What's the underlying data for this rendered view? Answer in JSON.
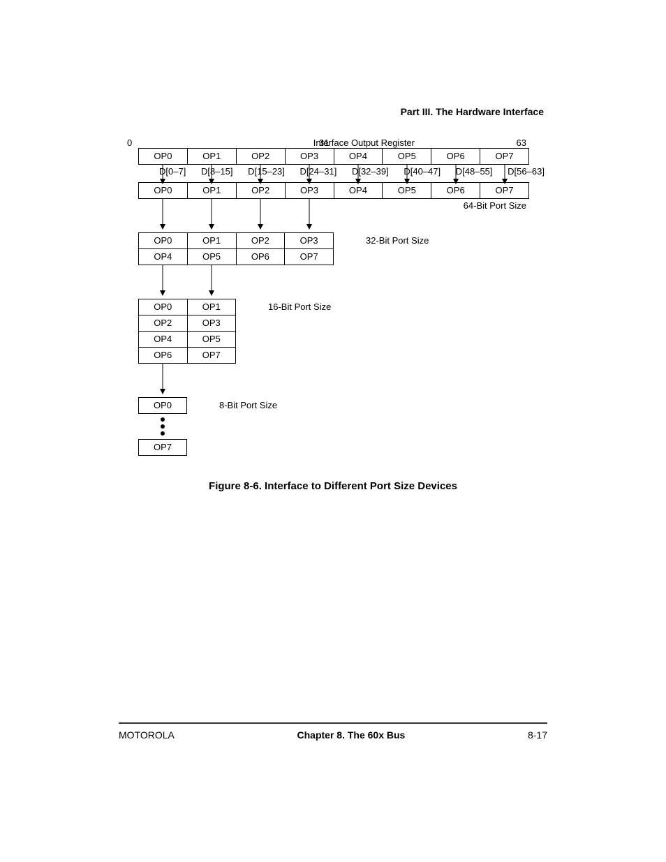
{
  "header": {
    "part": "Part III. The Hardware Interface"
  },
  "labels": {
    "ior": "Interface Output Register",
    "zero": "0",
    "mid": "31",
    "end": "63",
    "port64": "64-Bit Port Size",
    "port32": "32-Bit Port Size",
    "port16": "16-Bit Port Size",
    "port8": "8-Bit Port Size"
  },
  "row_top": [
    "OP0",
    "OP1",
    "OP2",
    "OP3",
    "OP4",
    "OP5",
    "OP6",
    "OP7"
  ],
  "row_d": [
    "D[0–7]",
    "D[8–15]",
    "D[15–23]",
    "D[24–31]",
    "D[32–39]",
    "D[40–47]",
    "D[48–55]",
    "D[56–63]"
  ],
  "row64": [
    "OP0",
    "OP1",
    "OP2",
    "OP3",
    "OP4",
    "OP5",
    "OP6",
    "OP7"
  ],
  "row32a": [
    "OP0",
    "OP1",
    "OP2",
    "OP3"
  ],
  "row32b": [
    "OP4",
    "OP5",
    "OP6",
    "OP7"
  ],
  "row16": [
    [
      "OP0",
      "OP1"
    ],
    [
      "OP2",
      "OP3"
    ],
    [
      "OP4",
      "OP5"
    ],
    [
      "OP6",
      "OP7"
    ]
  ],
  "row8_top": "OP0",
  "row8_bot": "OP7",
  "caption": "Figure 8-6. Interface to Different Port Size Devices",
  "footer": {
    "left": "MOTOROLA",
    "center": "Chapter 8. The 60x Bus",
    "right": "8-17"
  }
}
